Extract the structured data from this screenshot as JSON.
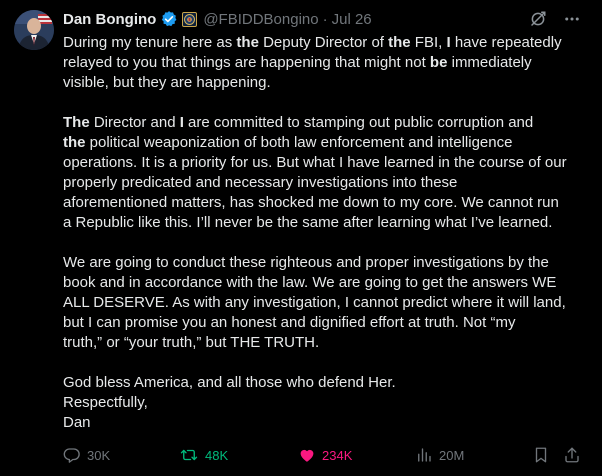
{
  "post": {
    "display_name": "Dan Bongino",
    "handle": "@FBIDDBongino",
    "separator": "·",
    "date": "Jul 26",
    "icons": {
      "verified": "verified-badge-icon",
      "affiliate": "fbi-seal-affiliate-icon",
      "grok": "grok-icon",
      "more": "more-icon"
    },
    "colors": {
      "verified_badge": "#1d9bf0",
      "repost_active": "#00ba7c",
      "like_active": "#f91880",
      "muted": "#71767b",
      "text": "#e7e9ea"
    },
    "body": {
      "p1": {
        "l1": [
          "During my tenure here as ",
          "the",
          " Deputy Director of ",
          "the",
          " FBI, ",
          "I",
          " have repeatedly"
        ],
        "l2": [
          "relayed to you that things are happening that might not ",
          "be",
          " immediately"
        ],
        "l3": "visible, but they are happening."
      },
      "p2": {
        "l1": [
          "The",
          " Director and ",
          "I",
          " are committed to stamping out public corruption and"
        ],
        "l2": [
          "the",
          " political weaponization of both law enforcement and intelligence"
        ],
        "l3": "operations. It is a priority for us. But what I have learned in the course of our",
        "l4": "properly predicated and necessary investigations into these",
        "l5": "aforementioned matters, has shocked me down to my core. We cannot run",
        "l6": "a Republic like this. I’ll never be the same after learning what I’ve learned."
      },
      "p3": {
        "l1": "We are going to conduct these righteous and proper investigations by the",
        "l2": "book and in accordance with the law. We are going to get the answers WE",
        "l3": "ALL DESERVE. As with any investigation, I cannot predict where it will land,",
        "l4": "but I can promise you an honest and dignified effort at truth. Not “my",
        "l5": "truth,” or “your truth,” but THE TRUTH."
      },
      "p4": {
        "l1": "God bless America, and all those who defend Her.",
        "l2": "Respectfully,",
        "l3": "Dan"
      }
    },
    "actions": {
      "replies": "30K",
      "reposts": "48K",
      "likes": "234K",
      "views": "20M"
    }
  }
}
